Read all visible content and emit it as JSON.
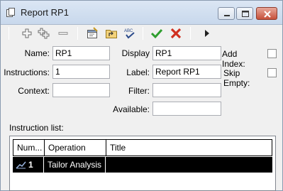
{
  "window": {
    "title": "Report RP1",
    "minimize_icon": "minimize-icon",
    "maximize_icon": "maximize-icon",
    "close_icon": "close-icon"
  },
  "toolbar": {
    "buttons": [
      "add-icon",
      "add-multiple-icon",
      "remove-icon",
      "properties-icon",
      "folder-up-icon",
      "spellcheck-icon",
      "accept-icon",
      "cancel-icon",
      "play-icon"
    ],
    "spellcheck_glyph": "ABC"
  },
  "form": {
    "name_label": "Name:",
    "name_value": "RP1",
    "instructions_label": "Instructions:",
    "instructions_value": "1",
    "context_label": "Context:",
    "context_value": "",
    "display_label": "Display",
    "display_value": "RP1",
    "title_label": "Label:",
    "title_value": "Report RP1",
    "filter_label": "Filter:",
    "filter_value": "",
    "available_label": "Available:",
    "available_value": "",
    "add_index_label": "Add Index:",
    "add_index_checked": false,
    "skip_empty_label": "Skip Empty:",
    "skip_empty_checked": false
  },
  "instruction_list": {
    "caption": "Instruction list:",
    "columns": [
      "Num...",
      "Operation",
      "Title"
    ],
    "rows": [
      {
        "num": "1",
        "operation": "Tailor Analysis",
        "title": "",
        "selected": true
      }
    ]
  },
  "colors": {
    "accept": "#2e9e2e",
    "cancel": "#d03020",
    "selection": "#000000"
  }
}
